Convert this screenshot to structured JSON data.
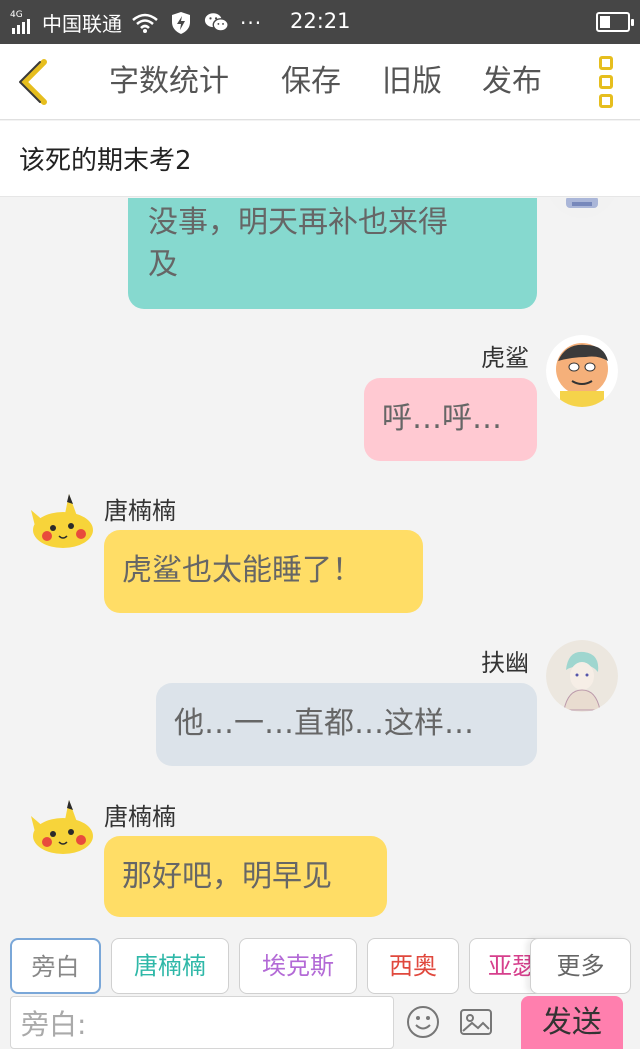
{
  "statusbar": {
    "network_type": "4G",
    "carrier": "中国联通",
    "dots": "···",
    "time": "22:21"
  },
  "toolbar": {
    "word_count": "字数统计",
    "save": "保存",
    "old_version": "旧版",
    "publish": "发布"
  },
  "title": "该死的期末考2",
  "messages": [
    {
      "speaker": "",
      "text_line1": "没事，明天再补也来得",
      "text_line2": "及",
      "color": "#86d9cf"
    },
    {
      "speaker": "虎鲨",
      "text": "呼…呼…",
      "color": "#ffc9d2"
    },
    {
      "speaker": "唐楠楠",
      "text": "虎鲨也太能睡了！",
      "color": "#ffdd66"
    },
    {
      "speaker": "扶幽",
      "text": "他…一…直都…这样…",
      "color": "#dce3ea"
    },
    {
      "speaker": "唐楠楠",
      "text": "那好吧，明早见",
      "color": "#ffdd66"
    }
  ],
  "roles": [
    {
      "label": "旁白",
      "color": "#888888"
    },
    {
      "label": "唐楠楠",
      "color": "#2fb8a8"
    },
    {
      "label": "埃克斯",
      "color": "#b36ad6"
    },
    {
      "label": "西奥",
      "color": "#e0483d"
    },
    {
      "label": "亚瑟",
      "color": "#d63f8c"
    }
  ],
  "more_roles": "更多",
  "input": {
    "placeholder": "旁白:"
  },
  "send": "发送",
  "icons": {
    "back": "chevron-left-icon",
    "more": "more-vertical-icon",
    "emoji": "emoji-icon",
    "image": "image-icon"
  }
}
